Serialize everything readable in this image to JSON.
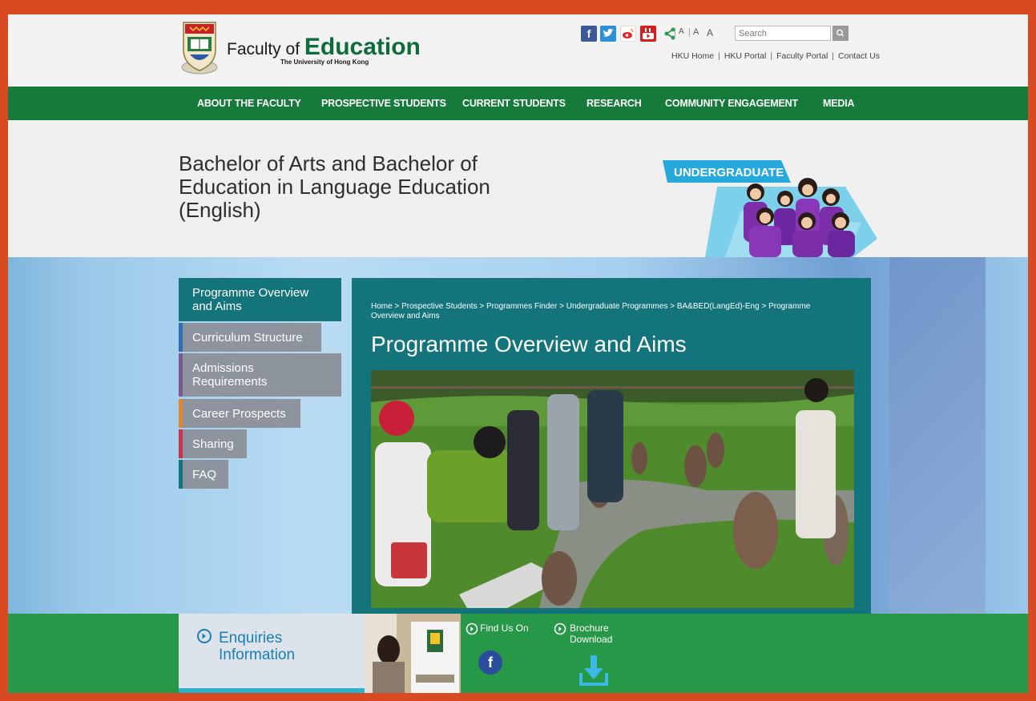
{
  "header": {
    "logo_prefix": "Faculty of ",
    "logo_main": "Education",
    "logo_sub": "The University of Hong Kong",
    "social_icons": [
      "facebook-icon",
      "twitter-icon",
      "weibo-icon",
      "youtube-icon",
      "share-icon"
    ],
    "facebook_glyph": "f",
    "font_sizes": [
      "A",
      "A",
      "A"
    ],
    "search": {
      "placeholder": "Search"
    },
    "util_links": [
      "HKU Home",
      "HKU Portal",
      "Faculty Portal",
      "Contact Us"
    ]
  },
  "nav": {
    "items": [
      "ABOUT THE FACULTY",
      "PROSPECTIVE STUDENTS",
      "CURRENT STUDENTS",
      "RESEARCH",
      "COMMUNITY ENGAGEMENT",
      "MEDIA"
    ]
  },
  "banner": {
    "title": "Bachelor of Arts and Bachelor of Education in Language Education (English)",
    "badge": "UNDERGRADUATE"
  },
  "sidebar": {
    "items": [
      {
        "label": "Programme Overview and Aims",
        "accent": "#14747c"
      },
      {
        "label": "Curriculum Structure",
        "accent": "#2f6db5"
      },
      {
        "label": "Admissions Requirements",
        "accent": "#7b5a8e"
      },
      {
        "label": "Career Prospects",
        "accent": "#e0852b"
      },
      {
        "label": "Sharing",
        "accent": "#c8344f"
      },
      {
        "label": "FAQ",
        "accent": "#14747c"
      }
    ]
  },
  "content": {
    "breadcrumb": "Home > Prospective Students > Programmes Finder > Undergraduate Programmes > BA&BED(LangEd)-Eng > Programme Overview and Aims",
    "title": "Programme Overview and Aims"
  },
  "footer": {
    "enquiries": "Enquiries Information",
    "find_us": "Find Us On",
    "brochure": "Brochure Download",
    "facebook_glyph": "f"
  },
  "colors": {
    "frame": "#d84a22",
    "nav_green": "#167b3a",
    "teal": "#14747c",
    "footer_green": "#269848"
  }
}
